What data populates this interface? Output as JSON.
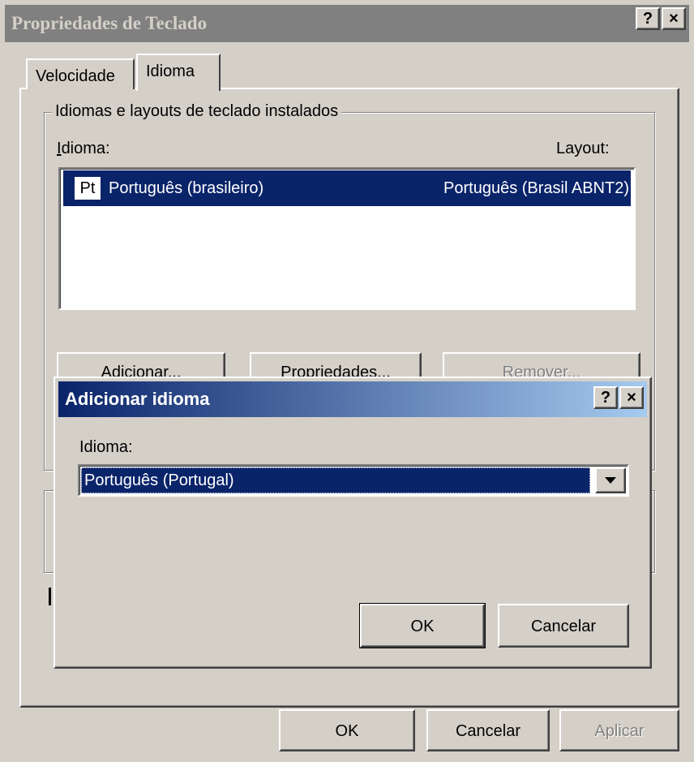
{
  "window": {
    "title": "Propriedades de Teclado",
    "help_glyph": "?",
    "close_glyph": "×"
  },
  "tabs": [
    {
      "label": "Velocidade",
      "active": false
    },
    {
      "label": "Idioma",
      "active": true
    }
  ],
  "installed": {
    "group_label": "Idiomas e layouts de teclado instalados",
    "col_language": "Idioma:",
    "col_layout": "Layout:",
    "rows": [
      {
        "badge": "Pt",
        "language": "Português (brasileiro)",
        "layout": "Português (Brasil ABNT2)",
        "selected": true
      }
    ],
    "add_button": "Adicionar...",
    "properties_button": "Propriedades...",
    "remove_button": "Remover..."
  },
  "footer": {
    "ok": "OK",
    "cancel": "Cancelar",
    "apply": "Aplicar"
  },
  "dialog": {
    "title": "Adicionar idioma",
    "help_glyph": "?",
    "close_glyph": "×",
    "field_label": "Idioma:",
    "selected_value": "Português (Portugal)",
    "ok": "OK",
    "cancel": "Cancelar"
  },
  "colors": {
    "face": "#d4d0c8",
    "selection": "#0a246a",
    "title_gradient_start": "#0a246a",
    "title_gradient_end": "#a6caf0",
    "inactive_title": "#808080"
  }
}
